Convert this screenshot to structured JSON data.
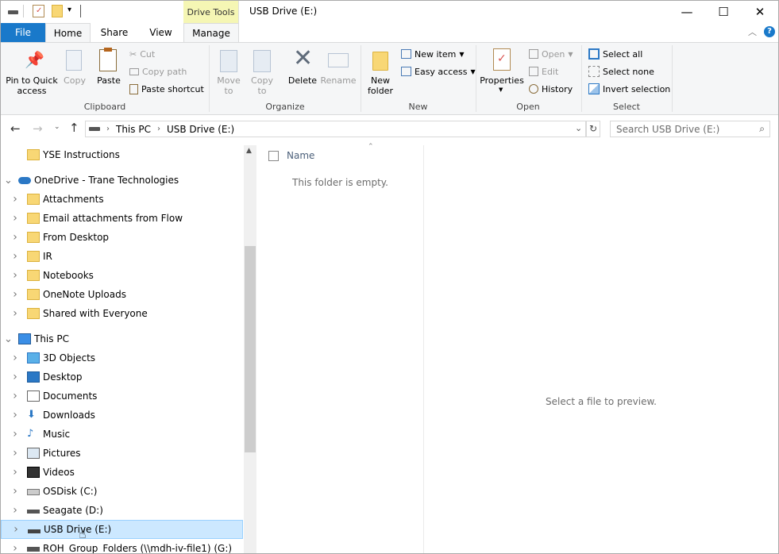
{
  "window": {
    "title": "USB Drive (E:)",
    "minimize_glyph": "—",
    "maximize_glyph": "☐",
    "close_glyph": "✕"
  },
  "ribbon": {
    "contextual_tab": "Drive Tools",
    "tabs": {
      "file": "File",
      "home": "Home",
      "share": "Share",
      "view": "View",
      "manage": "Manage"
    },
    "clipboard": {
      "group": "Clipboard",
      "pin": "Pin to Quick access",
      "copy": "Copy",
      "paste": "Paste",
      "cut": "Cut",
      "copy_path": "Copy path",
      "paste_shortcut": "Paste shortcut"
    },
    "organize": {
      "group": "Organize",
      "move_to": "Move to",
      "copy_to": "Copy to",
      "delete": "Delete",
      "rename": "Rename"
    },
    "new": {
      "group": "New",
      "new_folder": "New folder",
      "new_item": "New item",
      "easy_access": "Easy access"
    },
    "open": {
      "group": "Open",
      "properties": "Properties",
      "open": "Open",
      "edit": "Edit",
      "history": "History"
    },
    "select": {
      "group": "Select",
      "select_all": "Select all",
      "select_none": "Select none",
      "invert": "Invert selection"
    }
  },
  "address": {
    "crumbs": [
      "This PC",
      "USB Drive (E:)"
    ],
    "search_placeholder": "Search USB Drive (E:)"
  },
  "nav_items": [
    {
      "label": "YSE Instructions",
      "icon": "folder-icon",
      "level": 2,
      "expandable": false
    },
    {
      "label": "OneDrive - Trane Technologies",
      "icon": "cloud-icon",
      "level": 1,
      "expanded": true
    },
    {
      "label": "Attachments",
      "icon": "folder-icon",
      "level": 2
    },
    {
      "label": "Email attachments from Flow",
      "icon": "folder-icon",
      "level": 2
    },
    {
      "label": "From Desktop",
      "icon": "folder-icon",
      "level": 2
    },
    {
      "label": "IR",
      "icon": "folder-icon",
      "level": 2
    },
    {
      "label": "Notebooks",
      "icon": "folder-icon",
      "level": 2
    },
    {
      "label": "OneNote Uploads",
      "icon": "folder-icon",
      "level": 2
    },
    {
      "label": "Shared with Everyone",
      "icon": "folder-icon",
      "level": 2
    },
    {
      "label": "This PC",
      "icon": "computer-icon",
      "level": 1,
      "expanded": true
    },
    {
      "label": "3D Objects",
      "icon": "cube-icon",
      "level": 2
    },
    {
      "label": "Desktop",
      "icon": "desktop-icon",
      "level": 2
    },
    {
      "label": "Documents",
      "icon": "document-icon",
      "level": 2
    },
    {
      "label": "Downloads",
      "icon": "download-icon",
      "level": 2
    },
    {
      "label": "Music",
      "icon": "music-icon",
      "level": 2
    },
    {
      "label": "Pictures",
      "icon": "picture-icon",
      "level": 2
    },
    {
      "label": "Videos",
      "icon": "video-icon",
      "level": 2
    },
    {
      "label": "OSDisk (C:)",
      "icon": "windows-drive-icon",
      "level": 2
    },
    {
      "label": "Seagate (D:)",
      "icon": "drive-icon",
      "level": 2
    },
    {
      "label": "USB Drive (E:)",
      "icon": "usb-drive-icon",
      "level": 2,
      "selected": true
    },
    {
      "label": "ROH_Group_Folders (\\\\mdh-iv-file1) (G:)",
      "icon": "network-drive-icon",
      "level": 2
    }
  ],
  "content": {
    "column_name": "Name",
    "empty_message": "This folder is empty."
  },
  "preview": {
    "message": "Select a file to preview."
  },
  "colors": {
    "file_tab": "#1979ca",
    "selection": "#cce8ff",
    "contextual": "#f5f6b4",
    "folder": "#f8d775"
  }
}
